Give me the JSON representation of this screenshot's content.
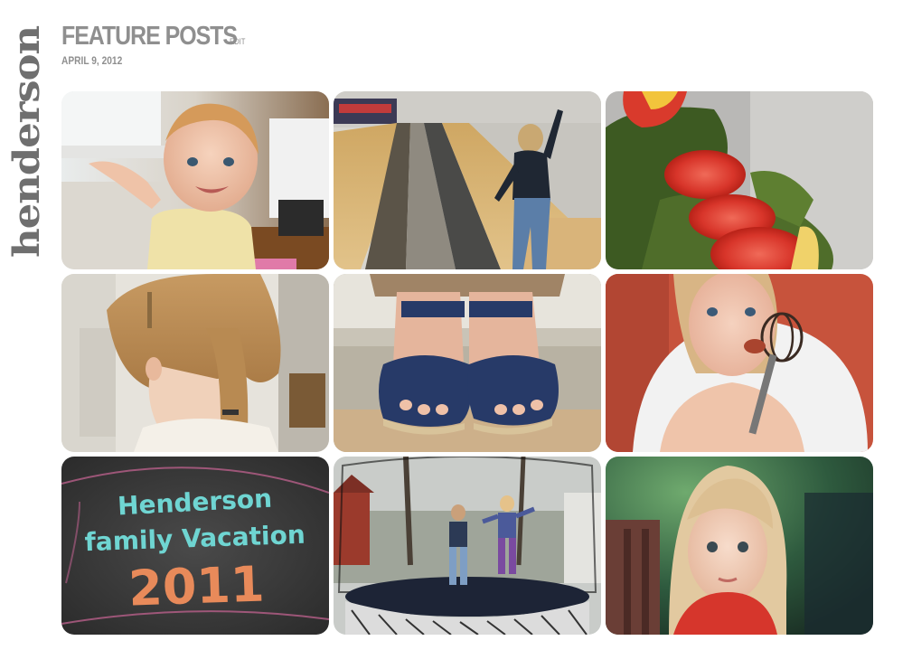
{
  "site": {
    "logo_text": "henderson"
  },
  "post": {
    "title": "FEATURE POSTS",
    "edit_label": "EDIT",
    "date": "APRIL 9, 2012"
  },
  "gallery": {
    "photos": [
      {
        "subject": "baby-at-window"
      },
      {
        "subject": "child-bowling"
      },
      {
        "subject": "tomato-salad"
      },
      {
        "subject": "girl-braid"
      },
      {
        "subject": "feet-sandals"
      },
      {
        "subject": "girl-licking-whisk"
      },
      {
        "subject": "chalk-drawing",
        "chalk_lines": [
          "Henderson",
          "family Vacation",
          "2011"
        ]
      },
      {
        "subject": "kids-trampoline"
      },
      {
        "subject": "girl-portrait"
      }
    ]
  }
}
